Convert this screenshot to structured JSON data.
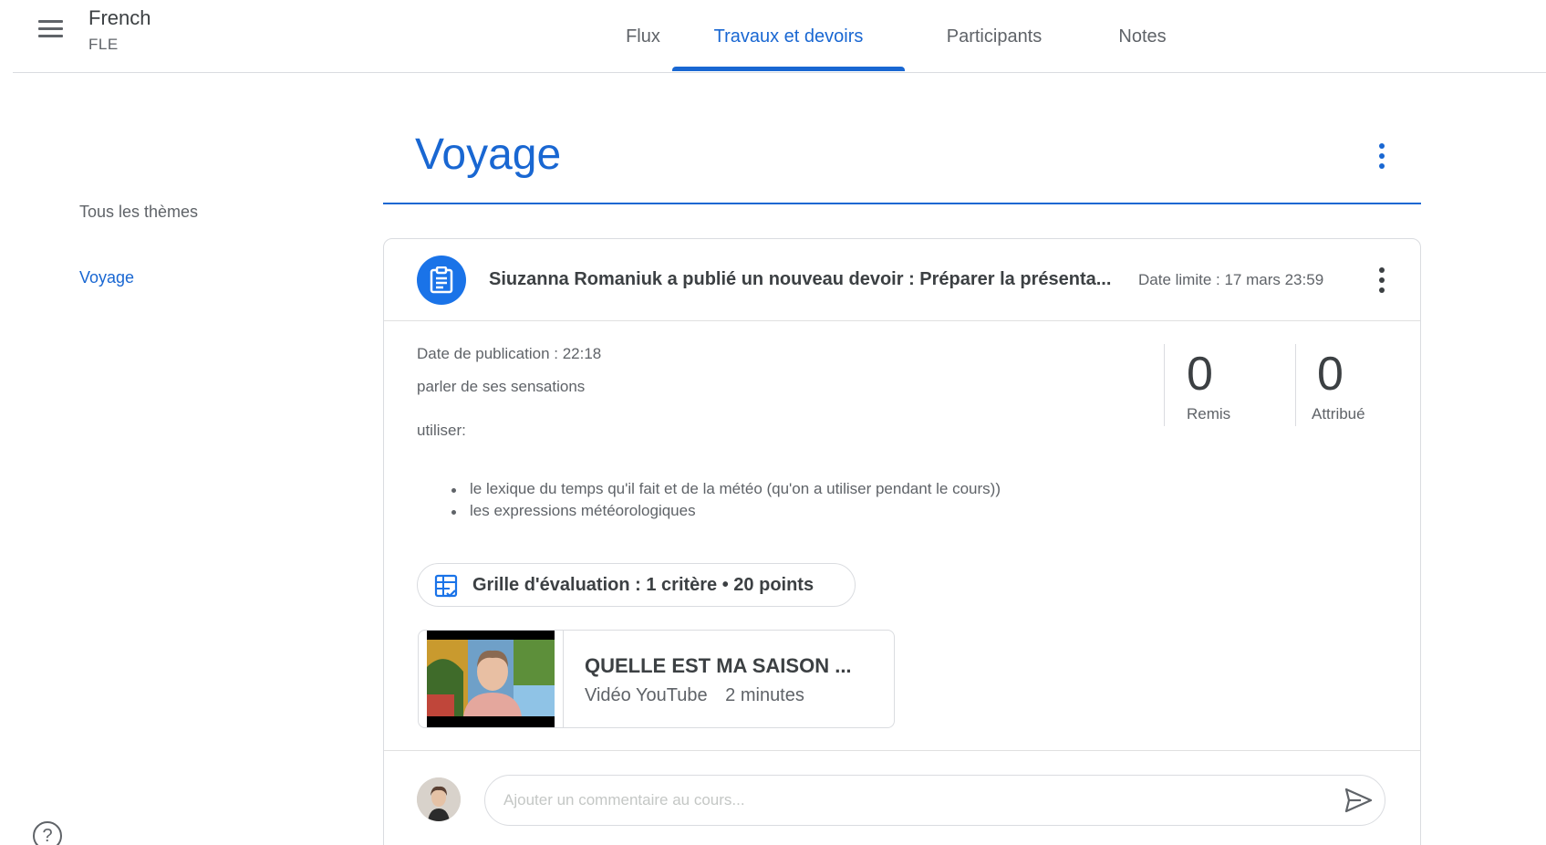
{
  "header": {
    "class_name": "French",
    "class_section": "FLE",
    "tabs": [
      {
        "label": "Flux",
        "active": false
      },
      {
        "label": "Travaux et devoirs",
        "active": true
      },
      {
        "label": "Participants",
        "active": false
      },
      {
        "label": "Notes",
        "active": false
      }
    ]
  },
  "sidebar": {
    "all_topics": "Tous les thèmes",
    "topics": [
      "Voyage"
    ]
  },
  "topic": {
    "title": "Voyage"
  },
  "assignment": {
    "title": "Siuzanna Romaniuk a publié un nouveau devoir : Préparer la présenta...",
    "due": "Date limite : 17 mars 23:59",
    "published": "Date de publication : 22:18",
    "description_line1": "parler de ses sensations",
    "description_line2": "utiliser:",
    "bullets": [
      "le lexique du temps qu'il fait et de la météo (qu'on a utiliser pendant le cours))",
      "les expressions météorologiques"
    ],
    "stats": [
      {
        "value": "0",
        "label": "Remis"
      },
      {
        "value": "0",
        "label": "Attribué"
      }
    ],
    "rubric": "Grille d'évaluation : 1 critère • 20 points",
    "attachment": {
      "title": "QUELLE EST MA SAISON ...",
      "type": "Vidéo YouTube",
      "duration": "2 minutes"
    },
    "comment_placeholder": "Ajouter un commentaire au cours..."
  },
  "colors": {
    "accent": "#1967d2",
    "icon_blue": "#1a73e8",
    "text_primary": "#3c4043",
    "text_secondary": "#5f6368",
    "divider": "#dadce0"
  },
  "icons": [
    "menu-icon",
    "more-vert-icon",
    "assignment-icon",
    "rubric-icon",
    "send-icon",
    "help-icon"
  ]
}
